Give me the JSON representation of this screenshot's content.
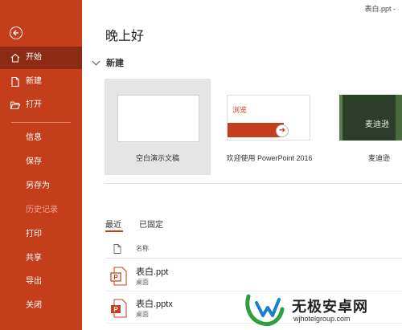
{
  "window": {
    "title": "表白.ppt  -"
  },
  "sidebar": {
    "background": "#c43e1c",
    "active_background": "#8c2a13",
    "top_items": [
      {
        "label": "开始",
        "icon": "home-icon"
      },
      {
        "label": "新建",
        "icon": "new-document-icon"
      },
      {
        "label": "打开",
        "icon": "open-folder-icon"
      }
    ],
    "items": [
      {
        "label": "信息"
      },
      {
        "label": "保存"
      },
      {
        "label": "另存为"
      },
      {
        "label": "历史记录"
      },
      {
        "label": "打印"
      },
      {
        "label": "共享"
      },
      {
        "label": "导出"
      },
      {
        "label": "关闭"
      }
    ]
  },
  "main": {
    "greeting": "晚上好",
    "new_section": "新建",
    "templates": [
      {
        "caption": "空白演示文稿"
      },
      {
        "caption": "欢迎使用 PowerPoint 2016",
        "thumb_text": "浏览"
      },
      {
        "caption": "麦迪逊",
        "thumb_text": "麦迪逊"
      }
    ],
    "tabs": {
      "recent": "最近",
      "pinned": "已固定"
    },
    "list_header": {
      "name": "名称"
    },
    "files": [
      {
        "name": "表白.ppt",
        "location": "桌面"
      },
      {
        "name": "表白.pptx",
        "location": "桌面"
      }
    ]
  },
  "watermark": {
    "title": "无极安卓网",
    "url": "wjhotelgroup.com"
  }
}
